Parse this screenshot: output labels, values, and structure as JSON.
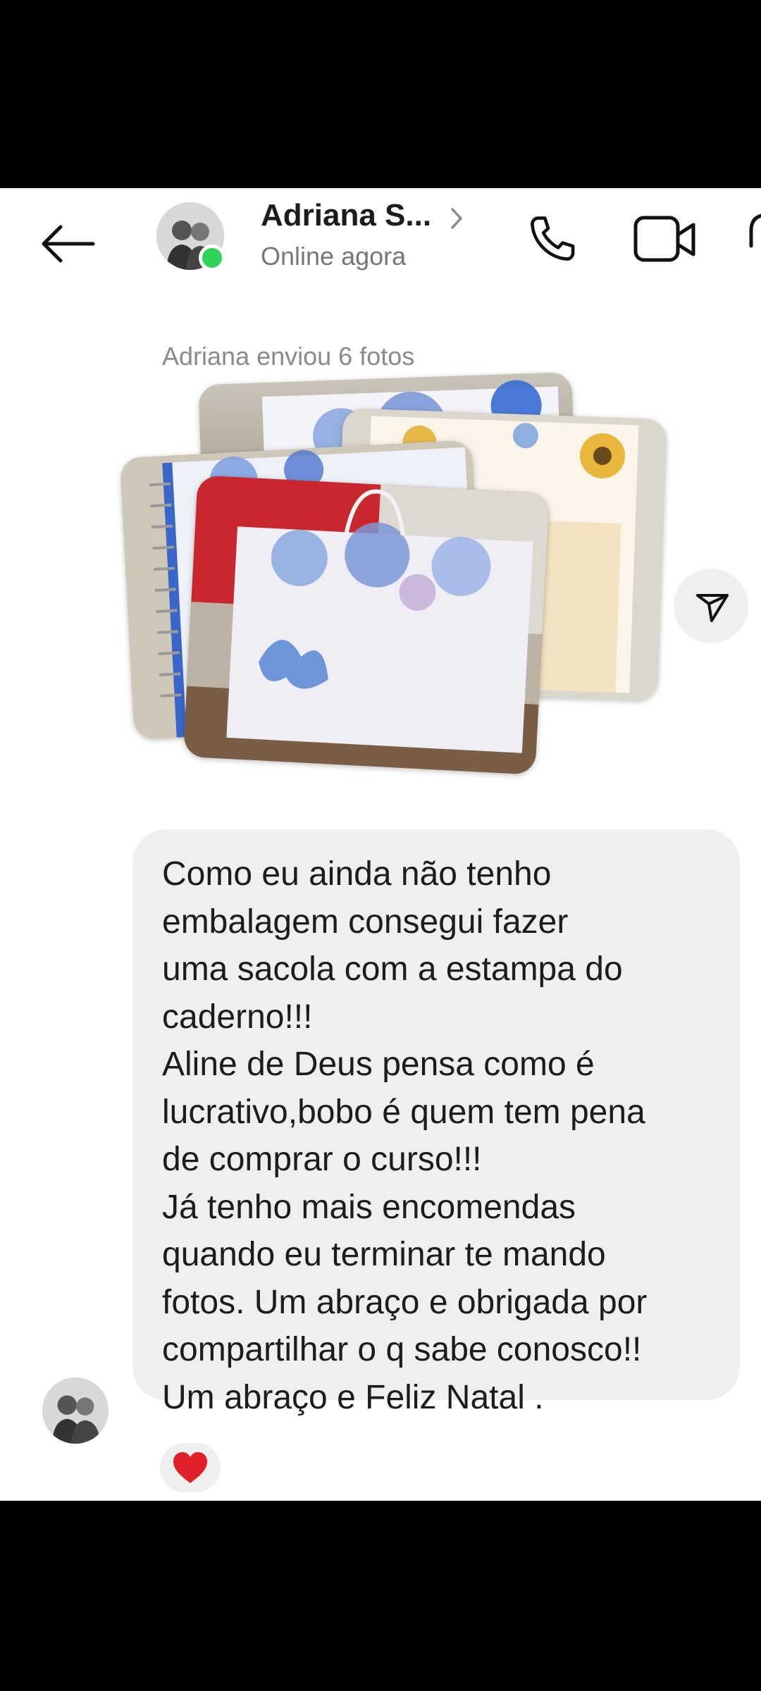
{
  "header": {
    "contact_name": "Adriana S...",
    "status": "Online agora",
    "icons": [
      "back-arrow-icon",
      "chevron-right-icon",
      "phone-icon",
      "video-camera-icon"
    ]
  },
  "conversation": {
    "photos_label": "Adriana enviou 6 fotos",
    "photo_count": 6,
    "message": "Como eu ainda não tenho\nembalagem consegui fazer\numa sacola com a estampa do\ncaderno!!!\nAline de Deus pensa como é\nlucrativo,bobo é quem tem pena\nde comprar o curso!!!\nJá tenho mais encomendas\nquando eu terminar te mando\nfotos. Um abraço e obrigada por\ncompartilhar o q sabe conosco!!\nUm abraço e Feliz Natal .",
    "reaction": "heart-icon"
  },
  "colors": {
    "online": "#2fd35a",
    "bubble": "#efefef",
    "heart": "#e0202a"
  }
}
